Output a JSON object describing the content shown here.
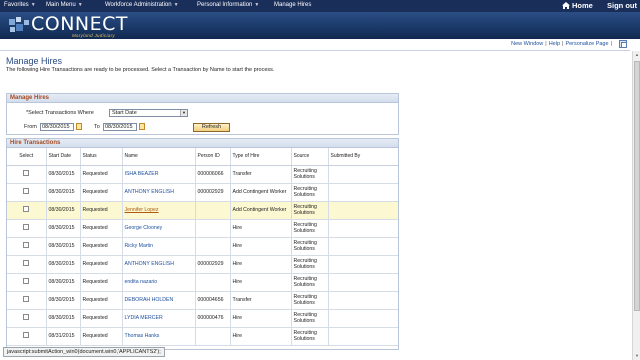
{
  "nav": {
    "menus": [
      "Favorites",
      "Main Menu",
      "Workforce Administration",
      "Personal Information",
      "Manage Hires"
    ],
    "home_label": "Home",
    "signout_label": "Sign out"
  },
  "branding": {
    "logo_text": "CONNECT",
    "logo_sub": "Maryland Judiciary"
  },
  "utility": {
    "links": [
      "New Window",
      "Help",
      "Personalize Page"
    ]
  },
  "page": {
    "title": "Manage Hires",
    "description": "The following Hire Transactions are ready to be processed. Select a Transaction by Name to start the process."
  },
  "manage_hires": {
    "header": "Manage Hires",
    "select_label": "*Select Transactions Where",
    "select_value": "Start Date",
    "from_label": "From",
    "from_value": "08/30/2015",
    "to_label": "To",
    "to_value": "08/30/2015",
    "refresh_label": "Refresh"
  },
  "hire_transactions": {
    "header": "Hire Transactions",
    "columns": [
      "Select",
      "Start Date",
      "Status",
      "Name",
      "Person ID",
      "Type of Hire",
      "Source",
      "Submitted By"
    ],
    "rows": [
      {
        "start": "08/30/2015",
        "status": "Requested",
        "name": "ISHA BEAZER",
        "pid": "000006066",
        "type": "Transfer",
        "source": "Recruiting Solutions",
        "by": ""
      },
      {
        "start": "08/30/2015",
        "status": "Requested",
        "name": "ANTHONY ENGLISH",
        "pid": "000002929",
        "type": "Add Contingent Worker",
        "source": "Recruiting Solutions",
        "by": ""
      },
      {
        "start": "08/30/2015",
        "status": "Requested",
        "name": "Jennifer Lopez",
        "pid": "",
        "type": "Add Contingent Worker",
        "source": "Recruiting Solutions",
        "by": ""
      },
      {
        "start": "08/30/2015",
        "status": "Requested",
        "name": "George Clooney",
        "pid": "",
        "type": "Hire",
        "source": "Recruiting Solutions",
        "by": ""
      },
      {
        "start": "08/30/2015",
        "status": "Requested",
        "name": "Ricky Martin",
        "pid": "",
        "type": "Hire",
        "source": "Recruiting Solutions",
        "by": ""
      },
      {
        "start": "08/30/2015",
        "status": "Requested",
        "name": "ANTHONY ENGLISH",
        "pid": "000002929",
        "type": "Hire",
        "source": "Recruiting Solutions",
        "by": ""
      },
      {
        "start": "08/30/2015",
        "status": "Requested",
        "name": "endita nazario",
        "pid": "",
        "type": "Hire",
        "source": "Recruiting Solutions",
        "by": ""
      },
      {
        "start": "08/30/2015",
        "status": "Requested",
        "name": "DEBORAH HOLDEN",
        "pid": "000004656",
        "type": "Transfer",
        "source": "Recruiting Solutions",
        "by": ""
      },
      {
        "start": "08/30/2015",
        "status": "Requested",
        "name": "LYDIA MERCER",
        "pid": "000000476",
        "type": "Hire",
        "source": "Recruiting Solutions",
        "by": ""
      },
      {
        "start": "08/31/2015",
        "status": "Requested",
        "name": "Thomas Hanks",
        "pid": "",
        "type": "Hire",
        "source": "Recruiting Solutions",
        "by": ""
      }
    ],
    "highlighted_row": 2
  },
  "statusbar": {
    "text": "javascript:submitAction_win0(document.win0,'APPLICANTS2');"
  },
  "colors": {
    "nav_bg": "#1a2e5a",
    "section_header_text": "#a54a22",
    "link": "#1c4f9c",
    "highlight_row": "#fbf8d2"
  }
}
